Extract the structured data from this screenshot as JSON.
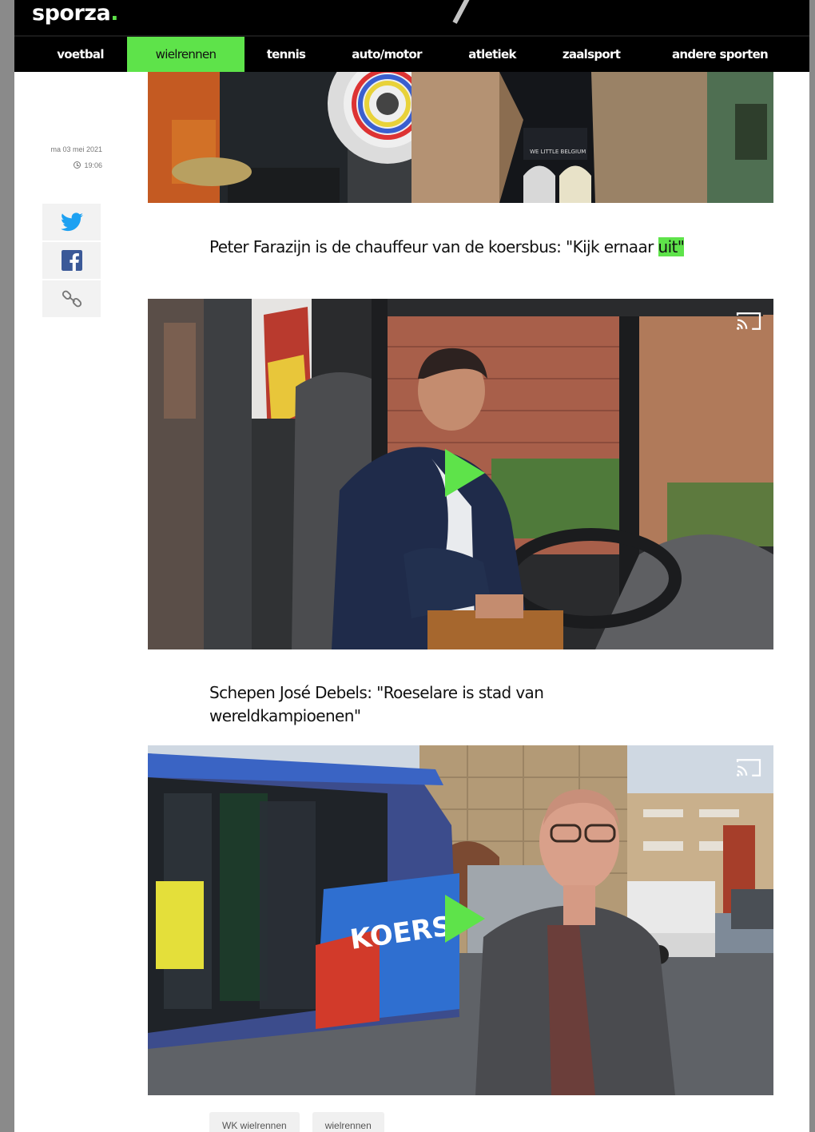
{
  "header": {
    "logo_text": "sporza",
    "logo_dot": ".",
    "nav": [
      {
        "label": "voetbal"
      },
      {
        "label": "wielrennen"
      },
      {
        "label": "tennis"
      },
      {
        "label": "auto/motor"
      },
      {
        "label": "atletiek"
      },
      {
        "label": "zaalsport"
      },
      {
        "label": "andere sporten"
      }
    ],
    "active_nav": "wielrennen"
  },
  "article": {
    "date": "ma 03 mei 2021",
    "time": "19:06",
    "share": [
      "twitter-icon",
      "facebook-icon",
      "link-icon"
    ]
  },
  "videos": [
    {
      "caption_main": "Peter Farazijn is de chauffeur van de koersbus: \"Kijk ernaar ",
      "caption_highlight": "uit\""
    },
    {
      "caption_main": "Schepen José Debels: \"Roeselare is stad van wereldkampioenen\"",
      "bus_label": "KOERS"
    }
  ],
  "tags": [
    "WK wielrennen",
    "wielrennen"
  ],
  "colors": {
    "accent": "#5ee34a",
    "header": "#000000",
    "twitter": "#1da1f2",
    "facebook": "#3b5998"
  }
}
